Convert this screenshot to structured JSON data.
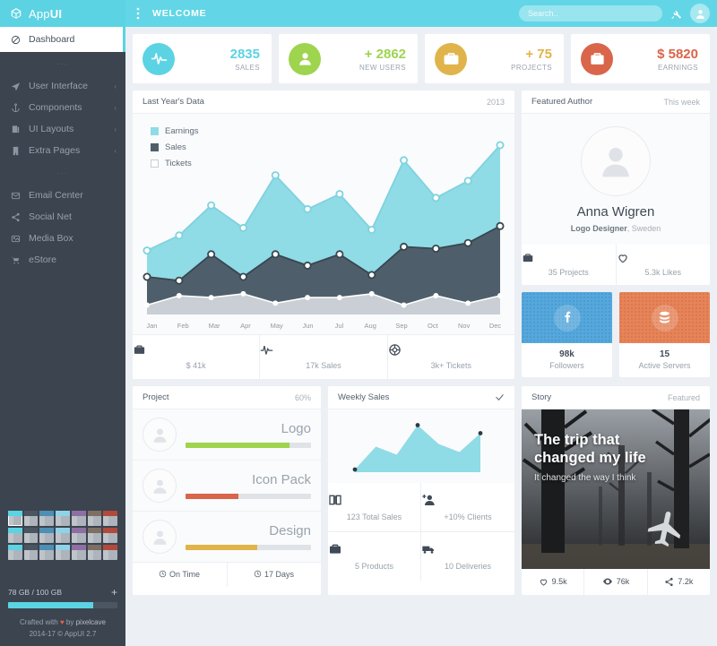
{
  "brand": {
    "name_light": "App",
    "name_bold": "UI",
    "logo_icon": "cube-icon"
  },
  "topbar": {
    "menu_icon": "menu-dots-icon",
    "title": "WELCOME",
    "search_placeholder": "Search..",
    "search_value": "",
    "wrench_icon": "wrench-icon",
    "avatar_icon": "user-avatar-icon"
  },
  "sidebar": {
    "active_item": {
      "label": "Dashboard",
      "icon": "dashboard-circle-icon"
    },
    "group1": [
      {
        "label": "User Interface",
        "icon": "paper-plane-icon",
        "caret": "‹"
      },
      {
        "label": "Components",
        "icon": "anchor-icon",
        "caret": "‹"
      },
      {
        "label": "UI Layouts",
        "icon": "layers-icon",
        "caret": "‹"
      },
      {
        "label": "Extra Pages",
        "icon": "building-icon",
        "caret": "‹"
      }
    ],
    "group2": [
      {
        "label": "Email Center",
        "icon": "envelope-icon"
      },
      {
        "label": "Social Net",
        "icon": "share-icon"
      },
      {
        "label": "Media Box",
        "icon": "image-icon"
      },
      {
        "label": "eStore",
        "icon": "cart-icon"
      }
    ],
    "separator": "···",
    "swatch_colors": [
      "#5bd3e3",
      "#4b5560",
      "#4d8fb5",
      "#8fd3e8",
      "#8e6fa3",
      "#7d6f63",
      "#b24a3c",
      "#5bd3e3",
      "#4b5560",
      "#4d8fb5",
      "#8fd3e8",
      "#8e6fa3",
      "#7d6f63",
      "#b24a3c",
      "#5bd3e3",
      "#4b5560",
      "#4d8fb5",
      "#8fd3e8",
      "#8e6fa3",
      "#7d6f63",
      "#b24a3c"
    ],
    "storage": {
      "label": "78 GB / 100 GB",
      "percent": 78,
      "add_icon": "plus-icon"
    },
    "credits": {
      "line1_pre": "Crafted with ",
      "line1_heart": "♥",
      "line1_mid": " by ",
      "line1_author": "pixelcave",
      "line2": "2014-17 © AppUI 2.7"
    }
  },
  "stats": [
    {
      "value": "2835",
      "label": "SALES",
      "color": "#5bd3e3",
      "value_color": "#5bd3e3",
      "icon": "pulse-icon"
    },
    {
      "value": "+ 2862",
      "label": "NEW USERS",
      "color": "#9ed44e",
      "value_color": "#9ed44e",
      "icon": "user-icon"
    },
    {
      "value": "+ 75",
      "label": "PROJECTS",
      "color": "#e0b44a",
      "value_color": "#e0b44a",
      "icon": "briefcase-icon"
    },
    {
      "value": "$ 5820",
      "label": "EARNINGS",
      "color": "#d9654a",
      "value_color": "#d9654a",
      "icon": "briefcase-alt-icon"
    }
  ],
  "main_chart": {
    "title": "Last Year's Data",
    "meta": "2013",
    "footer": [
      {
        "label": "$ 41k",
        "icon": "briefcase-icon"
      },
      {
        "label": "17k Sales",
        "icon": "pulse-icon"
      },
      {
        "label": "3k+ Tickets",
        "icon": "lifebuoy-icon"
      }
    ]
  },
  "chart_data": {
    "type": "area",
    "title": "Last Year's Data",
    "subtitle": "2013",
    "categories": [
      "Jan",
      "Feb",
      "Mar",
      "Apr",
      "May",
      "Jun",
      "Jul",
      "Aug",
      "Sep",
      "Oct",
      "Nov",
      "Dec"
    ],
    "series": [
      {
        "name": "Earnings",
        "color": "#8fdbe6",
        "values": [
          34,
          42,
          58,
          46,
          74,
          56,
          64,
          45,
          82,
          62,
          71,
          90
        ]
      },
      {
        "name": "Sales",
        "color": "#4e5f6b",
        "values": [
          20,
          18,
          32,
          20,
          32,
          26,
          32,
          21,
          36,
          35,
          38,
          47
        ]
      },
      {
        "name": "Tickets",
        "color": "#c9cfd5",
        "values": [
          5,
          10,
          9,
          11,
          6,
          9,
          9,
          11,
          5,
          10,
          6,
          10
        ]
      }
    ],
    "legend_position": "top-left",
    "ylim": [
      0,
      100
    ],
    "grid": false,
    "xlabel": "",
    "ylabel": ""
  },
  "author": {
    "title": "Featured Author",
    "meta": "This week",
    "avatar_icon": "user-avatar-icon",
    "name": "Anna Wigren",
    "role": "Logo Designer",
    "country": ", Sweden",
    "footer": [
      {
        "label": "35 Projects",
        "icon": "briefcase-icon"
      },
      {
        "label": "5.3k Likes",
        "icon": "heart-icon"
      }
    ]
  },
  "tiles": [
    {
      "number": "98k",
      "label": "Followers",
      "color": "#55a8dd",
      "icon": "facebook-icon"
    },
    {
      "number": "15",
      "label": "Active Servers",
      "color": "#e88358",
      "icon": "database-icon"
    }
  ],
  "project": {
    "title": "Project",
    "meta": "60%",
    "items": [
      {
        "name": "Logo",
        "percent": 83,
        "color": "#9ed44e",
        "avatar_icon": "user-avatar-icon"
      },
      {
        "name": "Icon Pack",
        "percent": 42,
        "color": "#d9654a",
        "avatar_icon": "user-avatar-icon"
      },
      {
        "name": "Design",
        "percent": 57,
        "color": "#e0b44a",
        "avatar_icon": "user-avatar-icon"
      }
    ],
    "footer": [
      {
        "label": "On Time",
        "icon": "clock-icon"
      },
      {
        "label": "17 Days",
        "icon": "clock-icon"
      }
    ]
  },
  "weekly_sales": {
    "title": "Weekly Sales",
    "meta_icon": "check-icon",
    "cells": [
      {
        "label": "123 Total Sales",
        "icon": "book-icon"
      },
      {
        "label": "+10% Clients",
        "icon": "user-plus-icon"
      },
      {
        "label": "5 Products",
        "icon": "briefcase-icon"
      },
      {
        "label": "10 Deliveries",
        "icon": "truck-icon"
      }
    ]
  },
  "weekly_chart": {
    "type": "area",
    "title": "Weekly Sales",
    "color": "#8fdbe6",
    "x": [
      1,
      2,
      3,
      4,
      5,
      6,
      7
    ],
    "values": [
      4,
      38,
      26,
      70,
      42,
      30,
      58
    ],
    "marker_points": [
      0,
      3,
      6
    ],
    "grid": false
  },
  "story": {
    "title": "Story",
    "meta": "Featured",
    "headline_line1": "The trip that",
    "headline_line2": "changed my life",
    "subhead": "It changed the way I think",
    "image_icon": "airplane-icon",
    "footer": [
      {
        "label": "9.5k",
        "icon": "heart-icon"
      },
      {
        "label": "76k",
        "icon": "eye-icon"
      },
      {
        "label": "7.2k",
        "icon": "share-icon"
      }
    ]
  }
}
